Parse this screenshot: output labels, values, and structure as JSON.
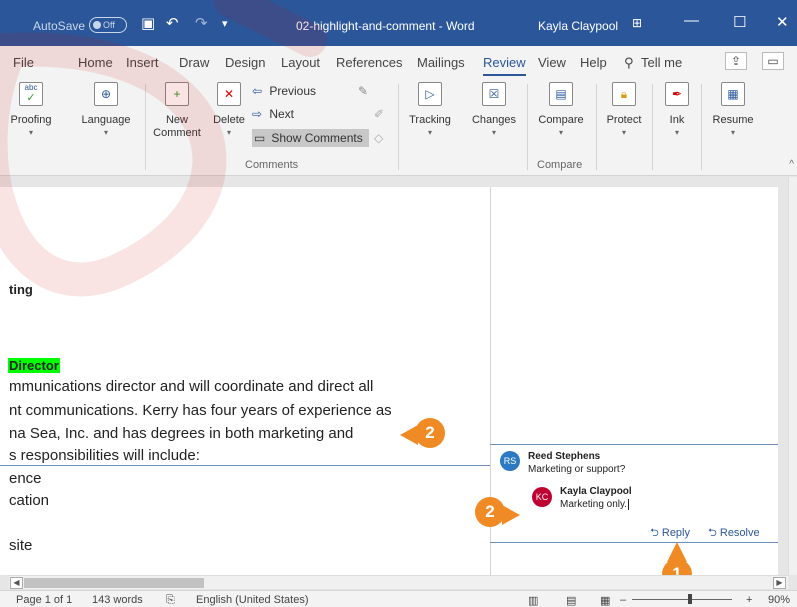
{
  "titlebar": {
    "autosave_label": "AutoSave",
    "autosave_state": "Off",
    "title": "02-highlight-and-comment - Word",
    "user": "Kayla Claypool"
  },
  "tabs": [
    "File",
    "Home",
    "Insert",
    "Draw",
    "Design",
    "Layout",
    "References",
    "Mailings",
    "Review",
    "View",
    "Help",
    "Tell me"
  ],
  "active_tab": "Review",
  "ribbon": {
    "proofing": "Proofing",
    "proofing_icon_text": "abc",
    "language": "Language",
    "new_comment": "New Comment",
    "new_comment_l1": "New",
    "new_comment_l2": "Comment",
    "delete": "Delete",
    "previous": "Previous",
    "next": "Next",
    "show_comments": "Show Comments",
    "comments_group": "Comments",
    "tracking": "Tracking",
    "changes": "Changes",
    "compare": "Compare",
    "compare_group": "Compare",
    "protect": "Protect",
    "ink": "Ink",
    "resume": "Resume"
  },
  "document": {
    "heading": "ting",
    "highlighted": "Director",
    "lines": [
      "mmunications director and will coordinate and direct all",
      "nt communications. Kerry has four years of experience as",
      "na Sea, Inc. and has degrees in both marketing and",
      "s responsibilities will include:",
      "ence",
      "cation",
      "site"
    ]
  },
  "comments": {
    "author1": "Reed Stephens",
    "initials1": "RS",
    "text1": "Marketing or support?",
    "author2": "Kayla Claypool",
    "initials2": "KC",
    "text2": "Marketing only.",
    "reply": "Reply",
    "resolve": "Resolve"
  },
  "callouts": {
    "one": "1",
    "two": "2"
  },
  "status": {
    "page": "Page 1 of 1",
    "words": "143 words",
    "language": "English (United States)",
    "zoom": "90%"
  },
  "colors": {
    "accent": "#2b579a",
    "highlight": "#00ff00",
    "callout": "#f08a24",
    "avatar_rs": "#2b79c2",
    "avatar_kc": "#c00030"
  }
}
